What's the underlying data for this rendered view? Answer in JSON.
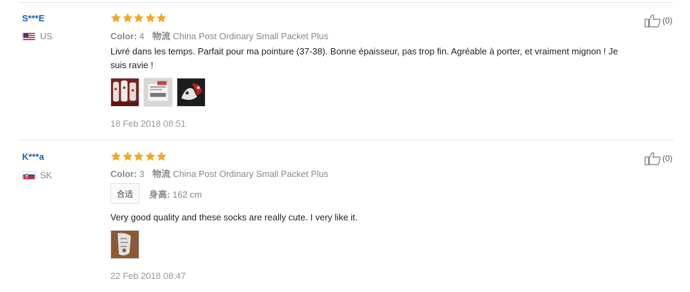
{
  "reviews": [
    {
      "user": "S***E",
      "country": "US",
      "flag_icon": "us-flag-icon",
      "rating": 5,
      "color_label": "Color:",
      "color_value": "4",
      "logistics_label": "物流",
      "logistics_value": "China Post Ordinary Small Packet Plus",
      "text_line1": "Livré dans les temps. Parfait pour ma pointure (37-38). Bonne épaisseur, pas trop fin. Agréable à porter, et vraiment mignon ! Je",
      "text_line2": "suis ravie !",
      "photos": [
        "photo-socks-pack",
        "photo-package-label",
        "photo-socks-worn"
      ],
      "date": "18 Feb 2018 08:51",
      "helpful_count": "(0)"
    },
    {
      "user": "K***a",
      "country": "SK",
      "flag_icon": "sk-flag-icon",
      "rating": 5,
      "color_label": "Color:",
      "color_value": "3",
      "logistics_label": "物流",
      "logistics_value": "China Post Ordinary Small Packet Plus",
      "fit_tag": "合适",
      "height_label": "身高:",
      "height_value": "162 cm",
      "text_line1": "Very good quality and these socks are really cute. I very like it.",
      "photos": [
        "photo-socks-worn"
      ],
      "date": "22 Feb 2018 08:47",
      "helpful_count": "(0)"
    }
  ],
  "colors": {
    "star": "#f5a623",
    "username": "#1a5fb4",
    "meta_text": "#888888"
  }
}
